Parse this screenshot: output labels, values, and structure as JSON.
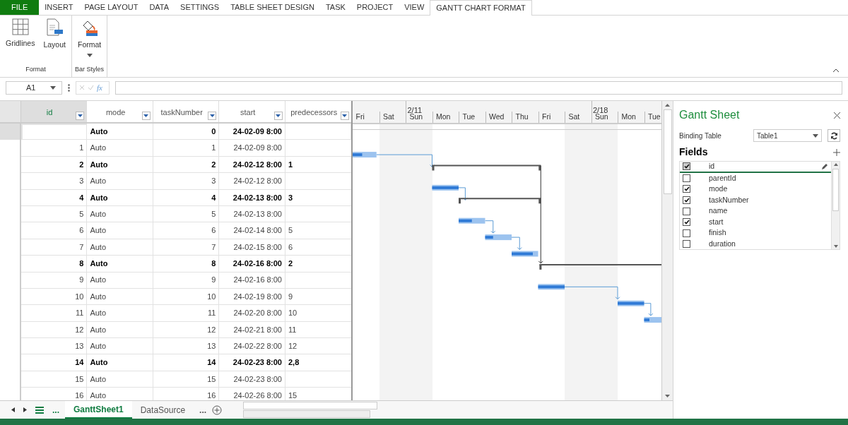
{
  "ribbon_tabs": [
    {
      "label": "FILE",
      "kind": "file",
      "selected": false
    },
    {
      "label": "INSERT",
      "kind": "tab",
      "selected": false
    },
    {
      "label": "PAGE LAYOUT",
      "kind": "tab",
      "selected": false
    },
    {
      "label": "DATA",
      "kind": "tab",
      "selected": false
    },
    {
      "label": "SETTINGS",
      "kind": "tab",
      "selected": false
    },
    {
      "label": "TABLE SHEET DESIGN",
      "kind": "tab",
      "selected": false
    },
    {
      "label": "TASK",
      "kind": "tab",
      "selected": false
    },
    {
      "label": "PROJECT",
      "kind": "tab",
      "selected": false
    },
    {
      "label": "VIEW",
      "kind": "tab",
      "selected": false
    },
    {
      "label": "GANTT CHART FORMAT",
      "kind": "tab",
      "selected": true
    }
  ],
  "ribbon_groups": [
    {
      "label": "Format",
      "buttons": [
        {
          "label": "Gridlines",
          "kind": "gridlines"
        },
        {
          "label": "Layout",
          "kind": "layout"
        }
      ]
    },
    {
      "label": "Bar Styles",
      "buttons": [
        {
          "label": "Format",
          "kind": "format",
          "dropdown": true
        }
      ]
    }
  ],
  "formula_bar": {
    "name_box": "A1",
    "fx": "fx"
  },
  "table": {
    "columns": [
      {
        "label": "id",
        "selected": true
      },
      {
        "label": "mode",
        "selected": false
      },
      {
        "label": "taskNumber",
        "selected": false
      },
      {
        "label": "start",
        "selected": false
      },
      {
        "label": "predecessors",
        "selected": false
      }
    ],
    "rows": [
      {
        "cells": [
          "",
          "Auto",
          "0",
          "24-02-09 8:00",
          ""
        ],
        "summary": true,
        "selected": true
      },
      {
        "cells": [
          "1",
          "Auto",
          "1",
          "24-02-09 8:00",
          ""
        ],
        "summary": false,
        "selected": false
      },
      {
        "cells": [
          "2",
          "Auto",
          "2",
          "24-02-12 8:00",
          "1"
        ],
        "summary": true,
        "selected": false
      },
      {
        "cells": [
          "3",
          "Auto",
          "3",
          "24-02-12 8:00",
          ""
        ],
        "summary": false,
        "selected": false
      },
      {
        "cells": [
          "4",
          "Auto",
          "4",
          "24-02-13 8:00",
          "3"
        ],
        "summary": true,
        "selected": false
      },
      {
        "cells": [
          "5",
          "Auto",
          "5",
          "24-02-13 8:00",
          ""
        ],
        "summary": false,
        "selected": false
      },
      {
        "cells": [
          "6",
          "Auto",
          "6",
          "24-02-14 8:00",
          "5"
        ],
        "summary": false,
        "selected": false
      },
      {
        "cells": [
          "7",
          "Auto",
          "7",
          "24-02-15 8:00",
          "6"
        ],
        "summary": false,
        "selected": false
      },
      {
        "cells": [
          "8",
          "Auto",
          "8",
          "24-02-16 8:00",
          "2"
        ],
        "summary": true,
        "selected": false
      },
      {
        "cells": [
          "9",
          "Auto",
          "9",
          "24-02-16 8:00",
          ""
        ],
        "summary": false,
        "selected": false
      },
      {
        "cells": [
          "10",
          "Auto",
          "10",
          "24-02-19 8:00",
          "9"
        ],
        "summary": false,
        "selected": false
      },
      {
        "cells": [
          "11",
          "Auto",
          "11",
          "24-02-20 8:00",
          "10"
        ],
        "summary": false,
        "selected": false
      },
      {
        "cells": [
          "12",
          "Auto",
          "12",
          "24-02-21 8:00",
          "11"
        ],
        "summary": false,
        "selected": false
      },
      {
        "cells": [
          "13",
          "Auto",
          "13",
          "24-02-22 8:00",
          "12"
        ],
        "summary": false,
        "selected": false
      },
      {
        "cells": [
          "14",
          "Auto",
          "14",
          "24-02-23 8:00",
          "2,8"
        ],
        "summary": true,
        "selected": false
      },
      {
        "cells": [
          "15",
          "Auto",
          "15",
          "24-02-23 8:00",
          ""
        ],
        "summary": false,
        "selected": false
      },
      {
        "cells": [
          "16",
          "Auto",
          "16",
          "24-02-26 8:00",
          "15"
        ],
        "summary": false,
        "selected": false
      }
    ]
  },
  "timescale": {
    "days": [
      {
        "label": "Fri",
        "weekend": false
      },
      {
        "label": "Sat",
        "weekend": true
      },
      {
        "label": "Sun",
        "weekend": true,
        "week": "2/11"
      },
      {
        "label": "Mon",
        "weekend": false
      },
      {
        "label": "Tue",
        "weekend": false
      },
      {
        "label": "Wed",
        "weekend": false
      },
      {
        "label": "Thu",
        "weekend": false
      },
      {
        "label": "Fri",
        "weekend": false
      },
      {
        "label": "Sat",
        "weekend": true
      },
      {
        "label": "Sun",
        "weekend": true,
        "week": "2/18"
      },
      {
        "label": "Mon",
        "weekend": false
      },
      {
        "label": "Tue",
        "weekend": false
      }
    ]
  },
  "sheet_tabs": [
    {
      "label": "GanttSheet1",
      "selected": true
    },
    {
      "label": "DataSource",
      "selected": false
    }
  ],
  "sheet_more": "...",
  "panel": {
    "title": "Gantt Sheet",
    "binding_label": "Binding Table",
    "binding_value": "Table1",
    "fields_title": "Fields",
    "fields": [
      {
        "label": "id",
        "checked": true,
        "selected": true
      },
      {
        "label": "parentId",
        "checked": false,
        "selected": false
      },
      {
        "label": "mode",
        "checked": true,
        "selected": false
      },
      {
        "label": "taskNumber",
        "checked": true,
        "selected": false
      },
      {
        "label": "name",
        "checked": false,
        "selected": false
      },
      {
        "label": "start",
        "checked": true,
        "selected": false
      },
      {
        "label": "finish",
        "checked": false,
        "selected": false
      },
      {
        "label": "duration",
        "checked": false,
        "selected": false
      }
    ]
  }
}
